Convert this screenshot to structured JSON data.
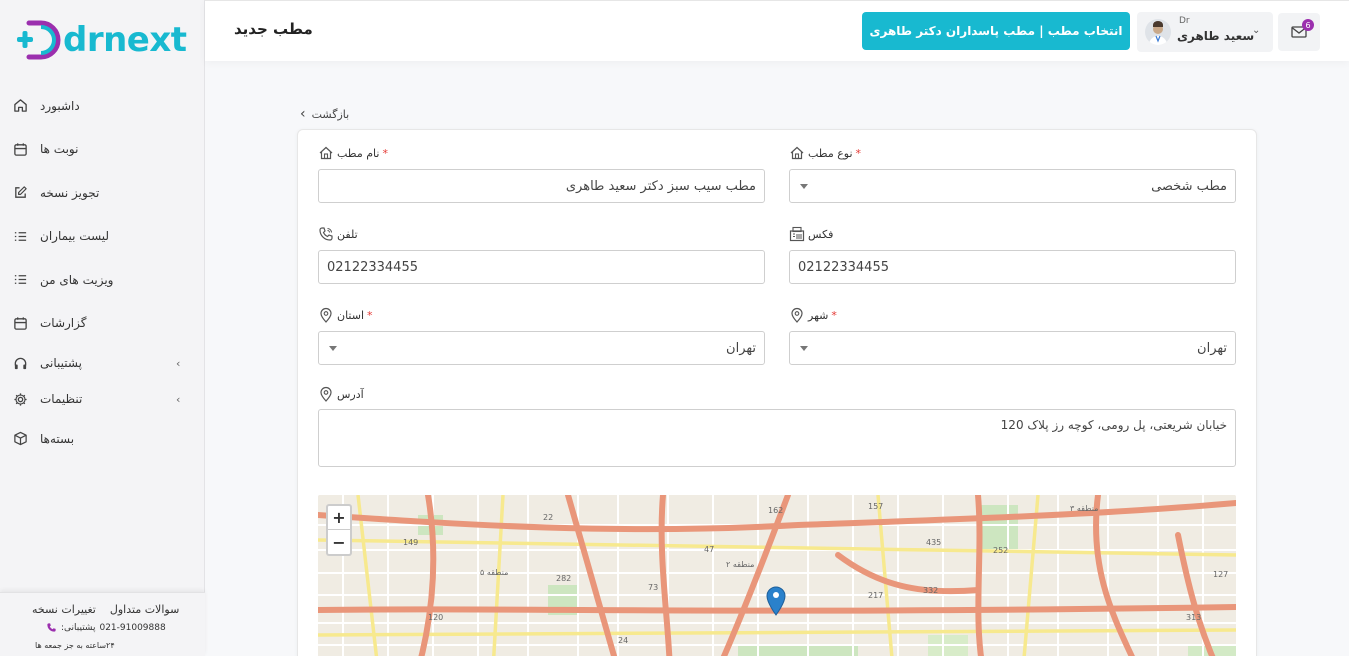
{
  "sidebar": {
    "logo_text": "drnext",
    "items": [
      {
        "label": "داشبورد",
        "icon": "home-icon"
      },
      {
        "label": "نوبت ها",
        "icon": "calendar-icon"
      },
      {
        "label": "تجویز نسخه",
        "icon": "edit-icon"
      },
      {
        "label": "لیست بیماران",
        "icon": "list-icon"
      },
      {
        "label": "ویزیت های من",
        "icon": "list-icon"
      },
      {
        "label": "گزارشات",
        "icon": "calendar-icon"
      },
      {
        "label": "پشتیبانی",
        "icon": "headset-icon",
        "has_submenu": true
      },
      {
        "label": "تنظیمات",
        "icon": "gear-icon",
        "has_submenu": true
      },
      {
        "label": "بسته‌ها",
        "icon": "box-icon"
      }
    ],
    "footer": {
      "faq": "سوالات متداول",
      "changes": "تغییرات نسخه",
      "support_label": "پشتیبانی:",
      "support_phone": "021-91009888",
      "hours": "۲۴ساعته به جز جمعه ها"
    }
  },
  "header": {
    "title": "مطب جدید",
    "clinic_button": "انتخاب مطب | مطب پاسداران دکتر طاهری",
    "user_prefix": "Dr",
    "user_name": "سعید طاهری",
    "notifications": "6"
  },
  "form": {
    "back": "بازگشت",
    "clinic_name_label": "نام مطب",
    "clinic_name_value": "مطب سیب سبز دکتر سعید طاهری",
    "clinic_type_label": "نوع مطب",
    "clinic_type_value": "مطب شخصی",
    "phone_label": "تلفن",
    "phone_value": "02122334455",
    "fax_label": "فکس",
    "fax_value": "02122334455",
    "province_label": "استان",
    "province_value": "تهران",
    "city_label": "شهر",
    "city_value": "تهران",
    "address_label": "آدرس",
    "address_value": "خیابان شریعتی، پل رومی، کوچه رز پلاک 120",
    "required_mark": "*"
  },
  "map": {
    "zoom_in": "+",
    "zoom_out": "−",
    "labels": [
      "منطقه ۳",
      "منطقه ۵",
      "منطقه ۲",
      "22",
      "162",
      "157",
      "435",
      "252",
      "149",
      "282",
      "47",
      "217",
      "332",
      "127",
      "313",
      "102",
      "120",
      "24",
      "73"
    ]
  },
  "colors": {
    "accent": "#18b9d0",
    "brand_purple": "#9b2fae",
    "required": "#e53935"
  }
}
